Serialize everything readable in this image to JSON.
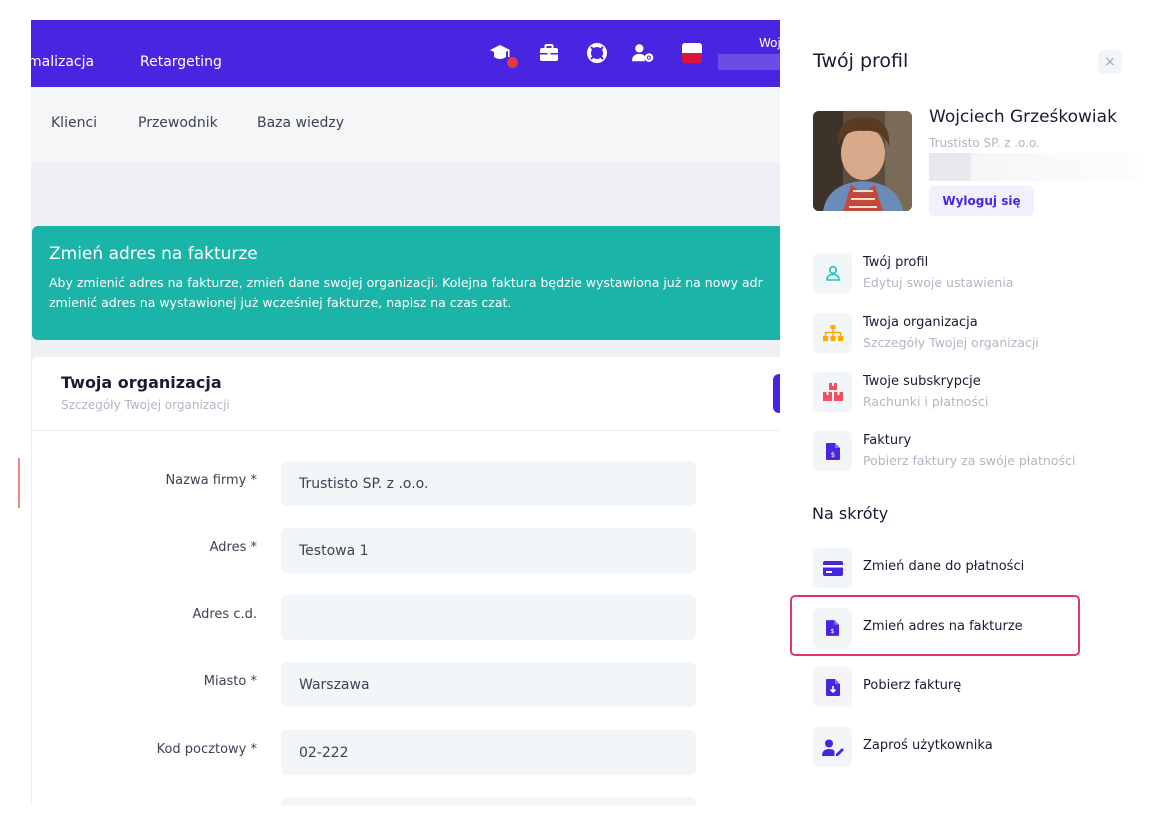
{
  "topbar": {
    "nav": [
      "malizacja",
      "Retargeting"
    ],
    "icons": [
      "graduation-cap-icon",
      "briefcase-icon",
      "lifebuoy-icon",
      "user-settings-icon",
      "flag-pl-icon"
    ],
    "user_partial": "Woj",
    "brand_color": "#4a25e1"
  },
  "subnav": [
    "Klienci",
    "Przewodnik",
    "Baza wiedzy"
  ],
  "alert": {
    "title": "Zmień adres na fakturze",
    "line1": "Aby zmienić adres na fakturze, zmień dane swojej organizacji. Kolejna faktura będzie wystawiona już na nowy adr",
    "line2": "zmienić adres na wystawionej już wcześniej fakturze, napisz na czas czat.",
    "color": "#1bb4a9"
  },
  "card": {
    "title": "Twoja organizacja",
    "subtitle": "Szczegóły Twojej organizacji"
  },
  "form": [
    {
      "label": "Nazwa firmy *",
      "value": "Trustisto SP. z .o.o."
    },
    {
      "label": "Adres *",
      "value": "Testowa 1"
    },
    {
      "label": "Adres c.d.",
      "value": ""
    },
    {
      "label": "Miasto *",
      "value": "Warszawa"
    },
    {
      "label": "Kod pocztowy *",
      "value": "02-222"
    }
  ],
  "panel": {
    "title": "Twój profil",
    "close": "×",
    "name": "Wojciech Grześkowiak",
    "company": "Trustisto SP. z .o.o.",
    "logout": "Wyloguj się",
    "menu": [
      {
        "title": "Twój profil",
        "sub": "Edytuj swoje ustawienia",
        "icon": "user-icon",
        "color": "#1bc5bd"
      },
      {
        "title": "Twoja organizacja",
        "sub": "Szczegóły Twojej organizacji",
        "icon": "sitemap-icon",
        "color": "#ffa800"
      },
      {
        "title": "Twoje subskrypcje",
        "sub": "Rachunki i płatności",
        "icon": "boxes-icon",
        "color": "#f64e60"
      },
      {
        "title": "Faktury",
        "sub": "Pobierz faktury za swóje płatności",
        "icon": "invoice-icon",
        "color": "#4a25e1"
      }
    ],
    "shortcuts_title": "Na skróty",
    "shortcuts": [
      {
        "label": "Zmień dane do płatności",
        "icon": "credit-card-icon"
      },
      {
        "label": "Zmień adres na fakturze",
        "icon": "invoice-icon"
      },
      {
        "label": "Pobierz fakturę",
        "icon": "file-download-icon"
      },
      {
        "label": "Zaproś użytkownika",
        "icon": "user-edit-icon"
      }
    ],
    "highlight_color": "#e0366e"
  }
}
